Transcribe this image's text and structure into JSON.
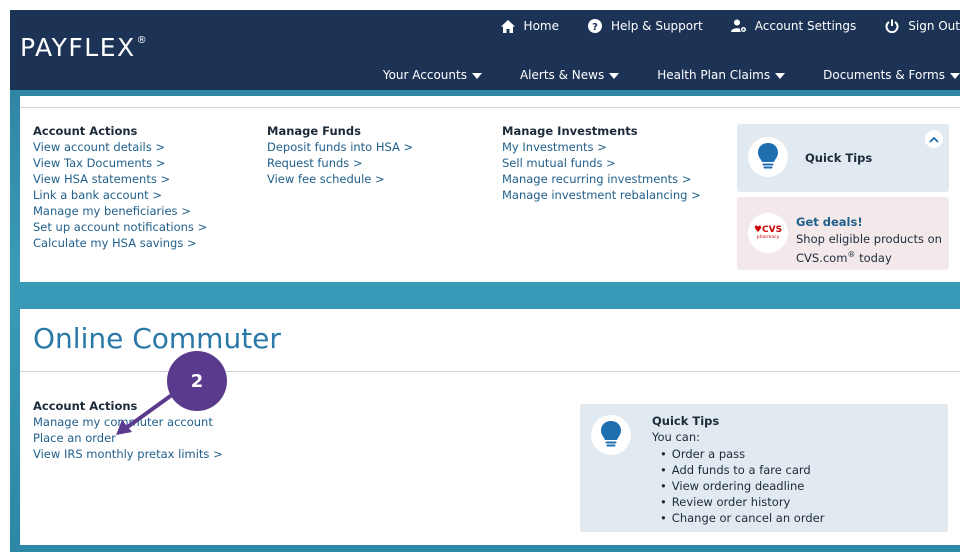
{
  "header": {
    "logo": "PAYFLEX",
    "logo_mark": "®",
    "top_nav": [
      {
        "label": "Home",
        "icon": "home-icon"
      },
      {
        "label": "Help & Support",
        "icon": "question-icon"
      },
      {
        "label": "Account Settings",
        "icon": "user-gear-icon"
      },
      {
        "label": "Sign Out",
        "icon": "power-icon"
      }
    ],
    "main_nav": [
      {
        "label": "Your Accounts"
      },
      {
        "label": "Alerts & News"
      },
      {
        "label": "Health Plan Claims"
      },
      {
        "label": "Documents & Forms"
      }
    ]
  },
  "hsa_panel": {
    "columns": [
      {
        "heading": "Account Actions",
        "links": [
          "View account details >",
          "View Tax Documents >",
          "View HSA statements >",
          "Link a bank account >",
          "Manage my beneficiaries >",
          "Set up account notifications >",
          "Calculate my HSA savings >"
        ]
      },
      {
        "heading": "Manage Funds",
        "links": [
          "Deposit funds into HSA >",
          "Request funds >",
          "View fee schedule >"
        ]
      },
      {
        "heading": "Manage Investments",
        "links": [
          "My Investments >",
          "Sell mutual funds >",
          "Manage recurring investments >",
          "Manage investment rebalancing >"
        ]
      }
    ],
    "quick_tips": {
      "title": "Quick Tips"
    },
    "deals": {
      "brand": "♥CVS",
      "brand_sub": "pharmacy",
      "title": "Get deals!",
      "text_1": "Shop eligible products on CVS.com",
      "text_reg": "®",
      "text_2": " today"
    }
  },
  "commuter_panel": {
    "title": "Online Commuter",
    "heading": "Account Actions",
    "links": [
      "Manage my commuter account",
      "Place an order",
      "View IRS monthly pretax limits >"
    ],
    "quick_tips": {
      "title": "Quick Tips",
      "intro": "You can:",
      "items": [
        "Order a pass",
        "Add funds to a fare card",
        "View ordering deadline",
        "Review order history",
        "Change or cancel an order"
      ]
    }
  },
  "annotation": {
    "step": "2"
  },
  "colors": {
    "header_bg": "#1d3356",
    "teal": "#3a9bb9",
    "link": "#1f5f8b",
    "title": "#2a79a8",
    "tips_bg": "#e2eaf1",
    "deals_bg": "#f3e9ea",
    "step_bg": "#5a3a8c"
  }
}
